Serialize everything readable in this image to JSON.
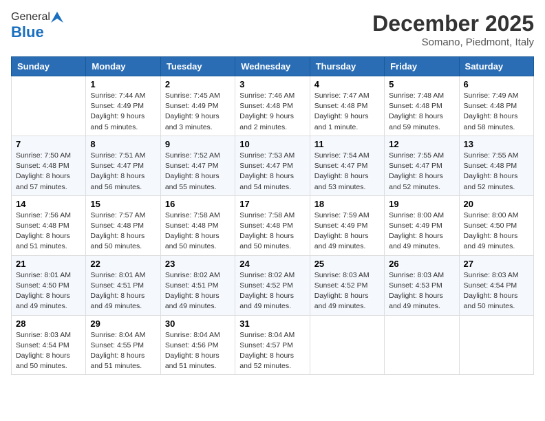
{
  "logo": {
    "general": "General",
    "blue": "Blue"
  },
  "header": {
    "month": "December 2025",
    "location": "Somano, Piedmont, Italy"
  },
  "weekdays": [
    "Sunday",
    "Monday",
    "Tuesday",
    "Wednesday",
    "Thursday",
    "Friday",
    "Saturday"
  ],
  "weeks": [
    [
      {
        "day": "",
        "sunrise": "",
        "sunset": "",
        "daylight": ""
      },
      {
        "day": "1",
        "sunrise": "Sunrise: 7:44 AM",
        "sunset": "Sunset: 4:49 PM",
        "daylight": "Daylight: 9 hours and 5 minutes."
      },
      {
        "day": "2",
        "sunrise": "Sunrise: 7:45 AM",
        "sunset": "Sunset: 4:49 PM",
        "daylight": "Daylight: 9 hours and 3 minutes."
      },
      {
        "day": "3",
        "sunrise": "Sunrise: 7:46 AM",
        "sunset": "Sunset: 4:48 PM",
        "daylight": "Daylight: 9 hours and 2 minutes."
      },
      {
        "day": "4",
        "sunrise": "Sunrise: 7:47 AM",
        "sunset": "Sunset: 4:48 PM",
        "daylight": "Daylight: 9 hours and 1 minute."
      },
      {
        "day": "5",
        "sunrise": "Sunrise: 7:48 AM",
        "sunset": "Sunset: 4:48 PM",
        "daylight": "Daylight: 8 hours and 59 minutes."
      },
      {
        "day": "6",
        "sunrise": "Sunrise: 7:49 AM",
        "sunset": "Sunset: 4:48 PM",
        "daylight": "Daylight: 8 hours and 58 minutes."
      }
    ],
    [
      {
        "day": "7",
        "sunrise": "Sunrise: 7:50 AM",
        "sunset": "Sunset: 4:48 PM",
        "daylight": "Daylight: 8 hours and 57 minutes."
      },
      {
        "day": "8",
        "sunrise": "Sunrise: 7:51 AM",
        "sunset": "Sunset: 4:47 PM",
        "daylight": "Daylight: 8 hours and 56 minutes."
      },
      {
        "day": "9",
        "sunrise": "Sunrise: 7:52 AM",
        "sunset": "Sunset: 4:47 PM",
        "daylight": "Daylight: 8 hours and 55 minutes."
      },
      {
        "day": "10",
        "sunrise": "Sunrise: 7:53 AM",
        "sunset": "Sunset: 4:47 PM",
        "daylight": "Daylight: 8 hours and 54 minutes."
      },
      {
        "day": "11",
        "sunrise": "Sunrise: 7:54 AM",
        "sunset": "Sunset: 4:47 PM",
        "daylight": "Daylight: 8 hours and 53 minutes."
      },
      {
        "day": "12",
        "sunrise": "Sunrise: 7:55 AM",
        "sunset": "Sunset: 4:47 PM",
        "daylight": "Daylight: 8 hours and 52 minutes."
      },
      {
        "day": "13",
        "sunrise": "Sunrise: 7:55 AM",
        "sunset": "Sunset: 4:48 PM",
        "daylight": "Daylight: 8 hours and 52 minutes."
      }
    ],
    [
      {
        "day": "14",
        "sunrise": "Sunrise: 7:56 AM",
        "sunset": "Sunset: 4:48 PM",
        "daylight": "Daylight: 8 hours and 51 minutes."
      },
      {
        "day": "15",
        "sunrise": "Sunrise: 7:57 AM",
        "sunset": "Sunset: 4:48 PM",
        "daylight": "Daylight: 8 hours and 50 minutes."
      },
      {
        "day": "16",
        "sunrise": "Sunrise: 7:58 AM",
        "sunset": "Sunset: 4:48 PM",
        "daylight": "Daylight: 8 hours and 50 minutes."
      },
      {
        "day": "17",
        "sunrise": "Sunrise: 7:58 AM",
        "sunset": "Sunset: 4:48 PM",
        "daylight": "Daylight: 8 hours and 50 minutes."
      },
      {
        "day": "18",
        "sunrise": "Sunrise: 7:59 AM",
        "sunset": "Sunset: 4:49 PM",
        "daylight": "Daylight: 8 hours and 49 minutes."
      },
      {
        "day": "19",
        "sunrise": "Sunrise: 8:00 AM",
        "sunset": "Sunset: 4:49 PM",
        "daylight": "Daylight: 8 hours and 49 minutes."
      },
      {
        "day": "20",
        "sunrise": "Sunrise: 8:00 AM",
        "sunset": "Sunset: 4:50 PM",
        "daylight": "Daylight: 8 hours and 49 minutes."
      }
    ],
    [
      {
        "day": "21",
        "sunrise": "Sunrise: 8:01 AM",
        "sunset": "Sunset: 4:50 PM",
        "daylight": "Daylight: 8 hours and 49 minutes."
      },
      {
        "day": "22",
        "sunrise": "Sunrise: 8:01 AM",
        "sunset": "Sunset: 4:51 PM",
        "daylight": "Daylight: 8 hours and 49 minutes."
      },
      {
        "day": "23",
        "sunrise": "Sunrise: 8:02 AM",
        "sunset": "Sunset: 4:51 PM",
        "daylight": "Daylight: 8 hours and 49 minutes."
      },
      {
        "day": "24",
        "sunrise": "Sunrise: 8:02 AM",
        "sunset": "Sunset: 4:52 PM",
        "daylight": "Daylight: 8 hours and 49 minutes."
      },
      {
        "day": "25",
        "sunrise": "Sunrise: 8:03 AM",
        "sunset": "Sunset: 4:52 PM",
        "daylight": "Daylight: 8 hours and 49 minutes."
      },
      {
        "day": "26",
        "sunrise": "Sunrise: 8:03 AM",
        "sunset": "Sunset: 4:53 PM",
        "daylight": "Daylight: 8 hours and 49 minutes."
      },
      {
        "day": "27",
        "sunrise": "Sunrise: 8:03 AM",
        "sunset": "Sunset: 4:54 PM",
        "daylight": "Daylight: 8 hours and 50 minutes."
      }
    ],
    [
      {
        "day": "28",
        "sunrise": "Sunrise: 8:03 AM",
        "sunset": "Sunset: 4:54 PM",
        "daylight": "Daylight: 8 hours and 50 minutes."
      },
      {
        "day": "29",
        "sunrise": "Sunrise: 8:04 AM",
        "sunset": "Sunset: 4:55 PM",
        "daylight": "Daylight: 8 hours and 51 minutes."
      },
      {
        "day": "30",
        "sunrise": "Sunrise: 8:04 AM",
        "sunset": "Sunset: 4:56 PM",
        "daylight": "Daylight: 8 hours and 51 minutes."
      },
      {
        "day": "31",
        "sunrise": "Sunrise: 8:04 AM",
        "sunset": "Sunset: 4:57 PM",
        "daylight": "Daylight: 8 hours and 52 minutes."
      },
      {
        "day": "",
        "sunrise": "",
        "sunset": "",
        "daylight": ""
      },
      {
        "day": "",
        "sunrise": "",
        "sunset": "",
        "daylight": ""
      },
      {
        "day": "",
        "sunrise": "",
        "sunset": "",
        "daylight": ""
      }
    ]
  ]
}
